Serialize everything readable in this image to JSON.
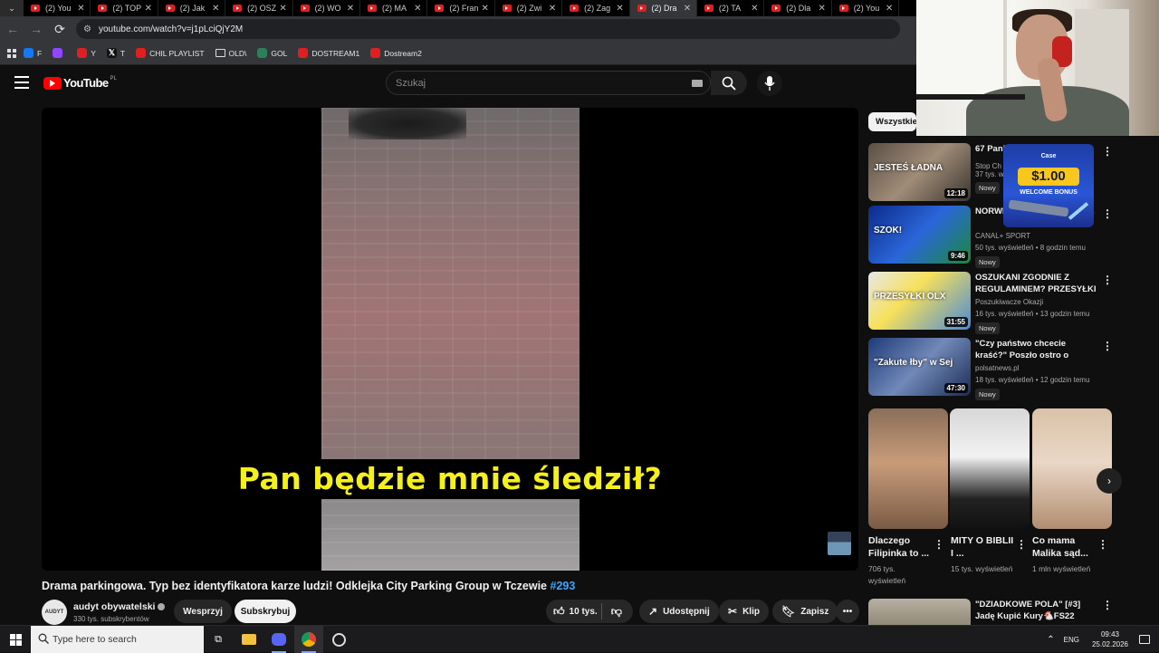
{
  "browser": {
    "tabs": [
      {
        "title": "(2) You",
        "active": false
      },
      {
        "title": "(2) TOP",
        "active": false
      },
      {
        "title": "(2) Jak",
        "active": false
      },
      {
        "title": "(2) OSZ",
        "active": false
      },
      {
        "title": "(2) WO",
        "active": false
      },
      {
        "title": "(2) MA",
        "active": false
      },
      {
        "title": "(2) Fran",
        "active": false
      },
      {
        "title": "(2) Zwi",
        "active": false
      },
      {
        "title": "(2) Zag",
        "active": false
      },
      {
        "title": "(2) Dra",
        "active": true
      },
      {
        "title": "(2) TA",
        "active": false
      },
      {
        "title": "(2) Dla",
        "active": false
      },
      {
        "title": "(2) You",
        "active": false
      }
    ],
    "url": "youtube.com/watch?v=j1pLciQjY2M",
    "bookmarks": [
      {
        "label": "F",
        "icon": "facebook-icon",
        "color": "#1877f2"
      },
      {
        "label": "",
        "icon": "twitch-icon",
        "color": "#9146ff"
      },
      {
        "label": "Y",
        "icon": "youtube-icon",
        "color": "#e02020"
      },
      {
        "label": "T",
        "icon": "x-icon",
        "color": "#111111"
      },
      {
        "label": "CHIL PLAYLIST",
        "icon": "youtube-icon",
        "color": "#e02020"
      },
      {
        "label": "OLD\\",
        "icon": "folder-icon",
        "color": "#35363a"
      },
      {
        "label": "GOL",
        "icon": "gol-icon",
        "color": "#2e7d5b"
      },
      {
        "label": "DOSTREAM1",
        "icon": "youtube-icon",
        "color": "#e02020"
      },
      {
        "label": "Dostream2",
        "icon": "youtube-icon",
        "color": "#e02020"
      }
    ]
  },
  "youtube": {
    "logo_text": "YouTube",
    "logo_country": "PL",
    "search_placeholder": "Szukaj",
    "video": {
      "caption": "Pan będzie mnie śledził?",
      "title": "Drama parkingowa. Typ bez identyfikatora karze ludzi! Odklejka City Parking Group w Tczewie",
      "hashtag": "#293",
      "channel": "audyt obywatelski",
      "channel_avatar_text": "AUDYT",
      "subscribers": "330 tys. subskrybentów",
      "support_label": "Wesprzyj",
      "subscribe_label": "Subskrybuj",
      "likes": "10 tys.",
      "share_label": "Udostępnij",
      "clip_label": "Klip",
      "save_label": "Zapisz"
    },
    "filter_chip": "Wszystkie",
    "recommendations": [
      {
        "title": "67 Pani",
        "channel": "Stop Ch",
        "meta": "37 tys. w",
        "badge": "Nowy",
        "duration": "12:18",
        "thumb_text": "JESTEŚ ŁADNA"
      },
      {
        "title": "NORWE... MEDIOL... MIEDZ...",
        "channel": "CANAL+ SPORT",
        "meta": "50 tys. wyświetleń • 8 godzin temu",
        "badge": "Nowy",
        "duration": "9:46",
        "thumb_text": "SZOK!"
      },
      {
        "title": "OSZUKANI ZGODNIE Z REGULAMINEM? PRZESYŁKI ...",
        "channel": "Poszukiwacze Okazji",
        "meta": "16 tys. wyświetleń • 13 godzin temu",
        "badge": "Nowy",
        "duration": "31:55",
        "thumb_text": "PRZESYŁKI OLX"
      },
      {
        "title": "\"Czy państwo chcecie kraść?\" Poszło ostro o procedury w ...",
        "channel": "polsatnews.pl",
        "meta": "18 tys. wyświetleń • 12 godzin temu",
        "badge": "Nowy",
        "duration": "47:30",
        "thumb_text": "\"Zakute łby\" w Sej"
      }
    ],
    "shorts": [
      {
        "title": "Dlaczego Filipinka to ...",
        "views": "706 tys. wyświetleń"
      },
      {
        "title": "MITY O BIBLII I ...",
        "views": "15 tys. wyświetleń"
      },
      {
        "title": "Co mama Malika sąd...",
        "views": "1 mln wyświetleń"
      }
    ],
    "bottom_rec": {
      "title": "\"DZIADKOWE POLA\" [#3] Jadę Kupić Kury🐔FS22"
    },
    "ad": {
      "brand": "Case",
      "amount": "$1.00",
      "bonus": "WELCOME BONUS"
    }
  },
  "taskbar": {
    "search_placeholder": "Type here to search",
    "lang": "ENG",
    "time": "09:43",
    "date": "25.02.2026"
  }
}
